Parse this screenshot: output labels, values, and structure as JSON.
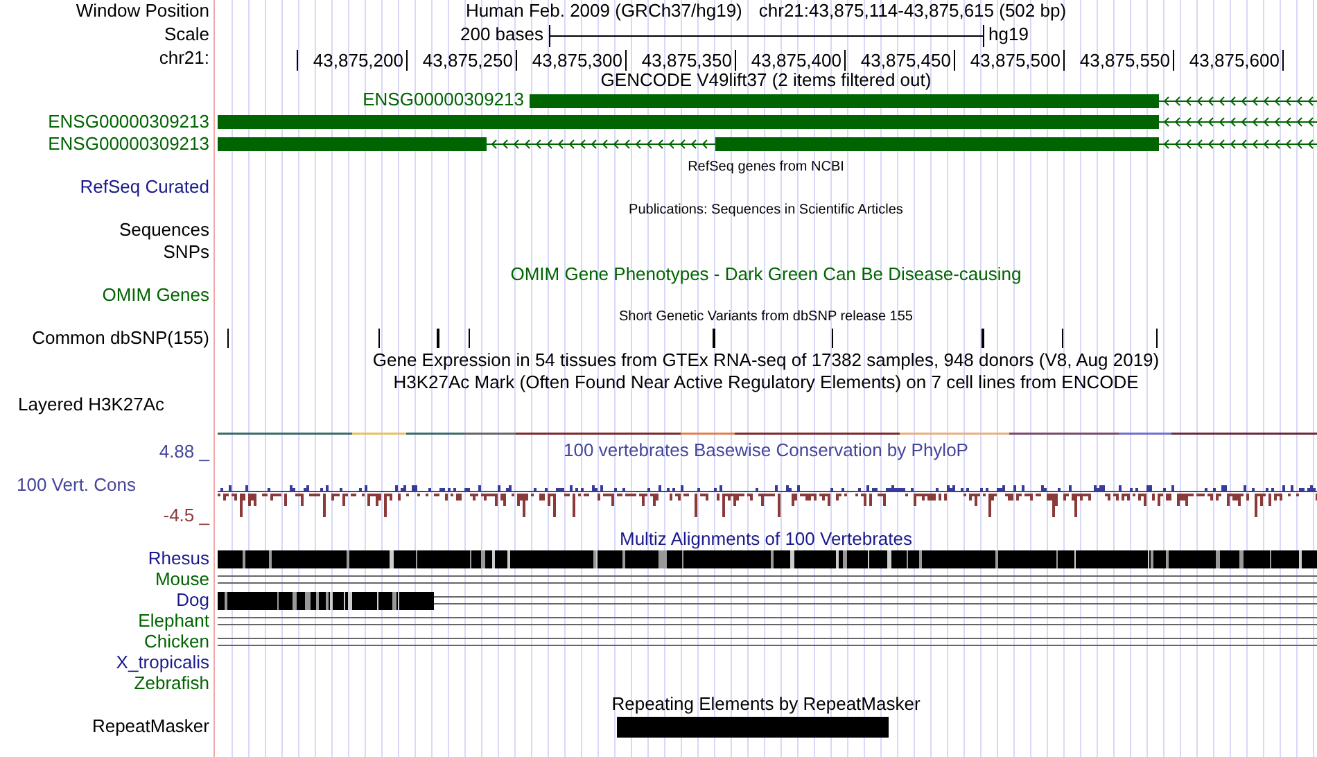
{
  "header": {
    "label": "Window Position",
    "assembly": "Human Feb. 2009 (GRCh37/hg19)",
    "position": "chr21:43,875,114-43,875,615 (502 bp)"
  },
  "scale": {
    "label": "Scale",
    "length": "200 bases",
    "db": "hg19"
  },
  "ruler": {
    "label": "chr21:",
    "ticks": [
      "43,875,200",
      "43,875,250",
      "43,875,300",
      "43,875,350",
      "43,875,400",
      "43,875,450",
      "43,875,500",
      "43,875,550",
      "43,875,600"
    ]
  },
  "tracks": [
    {
      "kind": "genes",
      "title": "GENCODE V49lift37 (2 items filtered out)",
      "genes": [
        {
          "name": "ENSG00000309213",
          "label_inline": true
        },
        {
          "name": "ENSG00000309213",
          "label_inline": false
        },
        {
          "name": "ENSG00000309213",
          "label_inline": false
        }
      ]
    },
    {
      "kind": "annotation",
      "title": "RefSeq genes from NCBI",
      "label": "RefSeq Curated",
      "color": "#1a1a8c"
    },
    {
      "kind": "annotation",
      "title": "Publications: Sequences in Scientific Articles",
      "label": "Sequences",
      "color": "#000000"
    },
    {
      "kind": "label",
      "label": "SNPs",
      "color": "#000000"
    },
    {
      "kind": "feature",
      "title": "OMIM Gene Phenotypes - Dark Green Can Be Disease-causing",
      "label": "OMIM Genes",
      "color": "#006400"
    },
    {
      "kind": "snps",
      "title": "Short Genetic Variants from dbSNP release 155",
      "label": "Common dbSNP(155)",
      "color": "#000000"
    },
    {
      "kind": "title",
      "title": "Gene Expression in 54 tissues from GTEx RNA-seq of 17382 samples, 948 donors (V8, Aug 2019)"
    },
    {
      "kind": "title",
      "title": "H3K27Ac Mark (Often Found Near Active Regulatory Elements) on 7 cell lines from ENCODE"
    },
    {
      "kind": "layered",
      "label": "Layered H3K27Ac",
      "color": "#000000"
    },
    {
      "kind": "conservation",
      "title": "100 vertebrates Basewise Conservation by PhyloP",
      "label": "100 Vert. Cons",
      "max": "4.88 _",
      "min": "-4.5 _",
      "color": "#45459a"
    },
    {
      "kind": "multiz",
      "title": "Multiz Alignments of 100 Vertebrates",
      "color": "#1a1a8c",
      "species": [
        {
          "name": "Rhesus",
          "color": "#1a1a8c",
          "kind": "full"
        },
        {
          "name": "Mouse",
          "color": "#006400",
          "kind": "gap"
        },
        {
          "name": "Dog",
          "color": "#1a1a8c",
          "kind": "partial"
        },
        {
          "name": "Elephant",
          "color": "#006400",
          "kind": "gap"
        },
        {
          "name": "Chicken",
          "color": "#006400",
          "kind": "gap"
        },
        {
          "name": "X_tropicalis",
          "color": "#1a1a8c",
          "kind": "none"
        },
        {
          "name": "Zebrafish",
          "color": "#006400",
          "kind": "none"
        }
      ]
    },
    {
      "kind": "repeats",
      "title": "Repeating Elements by RepeatMasker",
      "label": "RepeatMasker",
      "color": "#000000"
    }
  ]
}
